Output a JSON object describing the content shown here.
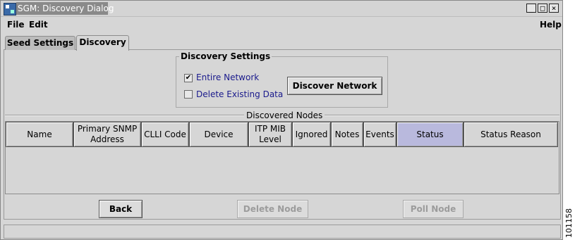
{
  "window": {
    "title": "SGM: Discovery Dialog",
    "controls": {
      "minimize": "_",
      "maximize": "□",
      "close": "×"
    }
  },
  "menu": {
    "file": "File",
    "edit": "Edit",
    "help": "Help"
  },
  "tabs": [
    {
      "label": "Seed Settings",
      "active": false
    },
    {
      "label": "Discovery",
      "active": true
    }
  ],
  "discovery_settings": {
    "title": "Discovery Settings",
    "entire_network": {
      "label": "Entire Network",
      "checked": true,
      "mark": "✔"
    },
    "delete_existing": {
      "label": "Delete Existing Data",
      "checked": false
    },
    "discover_button": "Discover Network"
  },
  "discovered_nodes": {
    "title": "Discovered Nodes",
    "columns": [
      {
        "label": "Name"
      },
      {
        "label": "Primary SNMP Address"
      },
      {
        "label": "CLLI Code"
      },
      {
        "label": "Device"
      },
      {
        "label": "ITP MIB Level"
      },
      {
        "label": "Ignored"
      },
      {
        "label": "Notes"
      },
      {
        "label": "Events"
      },
      {
        "label": "Status",
        "sorted": true
      },
      {
        "label": "Status Reason"
      }
    ],
    "rows": []
  },
  "buttons": {
    "back": "Back",
    "delete_node": "Delete Node",
    "poll_node": "Poll Node"
  },
  "status_text": "",
  "figure_id": "101158",
  "colors": {
    "sorted_header": "#b9b9dd",
    "checkbox_label": "#1a1a8c",
    "disabled_text": "#9c9c9c"
  }
}
